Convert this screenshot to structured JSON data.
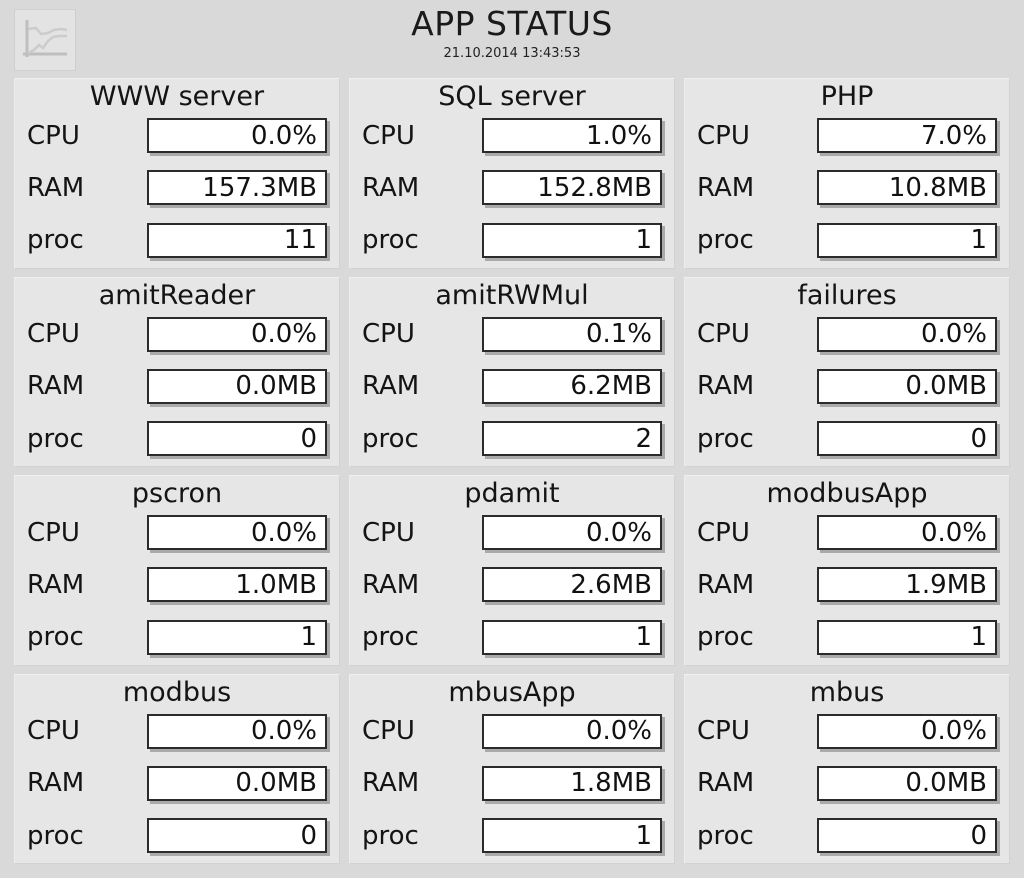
{
  "header": {
    "title": "APP STATUS",
    "timestamp": "21.10.2014 13:43:53",
    "logo_icon": "line-chart-icon"
  },
  "metric_labels": {
    "cpu": "CPU",
    "ram": "RAM",
    "proc": "proc"
  },
  "colors": {
    "page_background": "#d9d9d9",
    "panel_background": "#e6e6e6",
    "value_box_background": "#ffffff",
    "value_box_border": "#2b2b2b",
    "text": "#141414"
  },
  "panels": [
    {
      "name": "WWW server",
      "cpu": "0.0%",
      "ram": "157.3MB",
      "proc": "11"
    },
    {
      "name": "SQL server",
      "cpu": "1.0%",
      "ram": "152.8MB",
      "proc": "1"
    },
    {
      "name": "PHP",
      "cpu": "7.0%",
      "ram": "10.8MB",
      "proc": "1"
    },
    {
      "name": "amitReader",
      "cpu": "0.0%",
      "ram": "0.0MB",
      "proc": "0"
    },
    {
      "name": "amitRWMul",
      "cpu": "0.1%",
      "ram": "6.2MB",
      "proc": "2"
    },
    {
      "name": "failures",
      "cpu": "0.0%",
      "ram": "0.0MB",
      "proc": "0"
    },
    {
      "name": "pscron",
      "cpu": "0.0%",
      "ram": "1.0MB",
      "proc": "1"
    },
    {
      "name": "pdamit",
      "cpu": "0.0%",
      "ram": "2.6MB",
      "proc": "1"
    },
    {
      "name": "modbusApp",
      "cpu": "0.0%",
      "ram": "1.9MB",
      "proc": "1"
    },
    {
      "name": "modbus",
      "cpu": "0.0%",
      "ram": "0.0MB",
      "proc": "0"
    },
    {
      "name": "mbusApp",
      "cpu": "0.0%",
      "ram": "1.8MB",
      "proc": "1"
    },
    {
      "name": "mbus",
      "cpu": "0.0%",
      "ram": "0.0MB",
      "proc": "0"
    }
  ]
}
